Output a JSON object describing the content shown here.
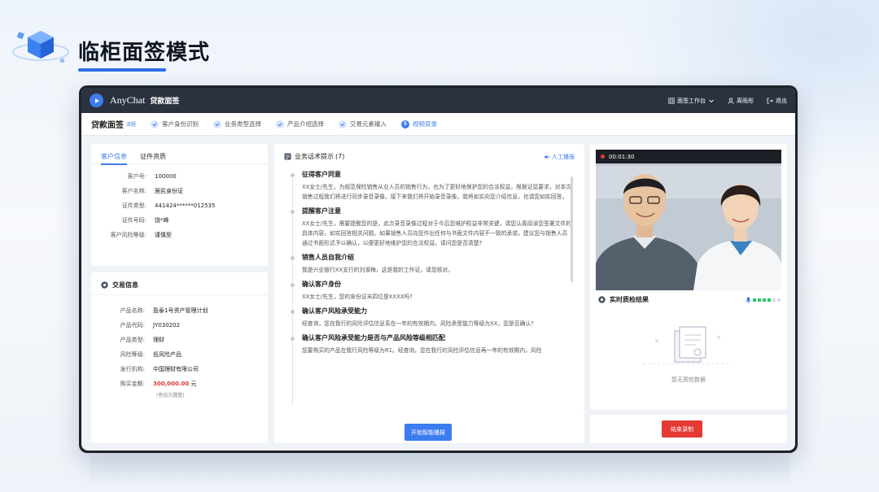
{
  "hero": {
    "title": "临柜面签模式"
  },
  "topbar": {
    "brand": "AnyChat",
    "app_name": "贷款面签",
    "workspace": "面签工作台",
    "user": "周雨彤",
    "logout": "退出"
  },
  "stepbar": {
    "title": "贷款面签",
    "tag": "流程",
    "steps": [
      {
        "label": "客户身份识别"
      },
      {
        "label": "业务类型选择"
      },
      {
        "label": "产品介绍选择"
      },
      {
        "label": "交易元素输入"
      },
      {
        "label": "视频双录",
        "num": "5"
      }
    ]
  },
  "customer": {
    "tabs": [
      "客户信息",
      "证件资质"
    ],
    "fields": [
      {
        "k": "客户号:",
        "v": "100000"
      },
      {
        "k": "客户名称:",
        "v": "居民身份证"
      },
      {
        "k": "证件类型:",
        "v": "441424******012535"
      },
      {
        "k": "证件号码:",
        "v": "饶*峰"
      },
      {
        "k": "客户风险等级:",
        "v": "谨慎型"
      }
    ]
  },
  "trade": {
    "title": "交易信息",
    "fields": [
      {
        "k": "产品名称:",
        "v": "盈泰1号资产管理计划"
      },
      {
        "k": "产品代码:",
        "v": "JY030202"
      },
      {
        "k": "产品类型:",
        "v": "理财"
      },
      {
        "k": "风险等级:",
        "v": "低风险产品"
      },
      {
        "k": "发行机构:",
        "v": "中国理财有限公司"
      }
    ],
    "amount_label": "购买金额:",
    "amount": "300,000.00",
    "amount_unit": "元",
    "amount_note": "(叁拾万圆整)"
  },
  "script": {
    "title": "业务话术提示",
    "count": "(7)",
    "manual": "人工播报",
    "items": [
      {
        "title": "征得客户同意",
        "body": "XX女士/先生，为规范保险销售从业人员的销售行为，也为了更好地保护您的合法权益，根据证监要求，对本次销售过程我们将进行同步录音录像。接下来我们将开始录音录像，我将如实向您介绍信息，也请您如实回答。"
      },
      {
        "title": "提醒客户注意",
        "body": "XX女士/先生，需要提醒您的是，此次录音录像过程对于今后您维护权益非常关键，请您认真阅读您签署文件的具体内容，如实回答相关问题。如果销售人员向您作出任何与书面文件内容不一致的承诺，建议您与销售人员通过书面形式予以确认，以便更好地维护您的合法权益。请问您是否清楚?"
      },
      {
        "title": "销售人员自我介绍",
        "body": "我是兴业银行XX支行的刘淑梅，这是我的工作证，请您核对。"
      },
      {
        "title": "确认客户身份",
        "body": "XX女士/先生，您的身份证末四位是XXXX吗?"
      },
      {
        "title": "确认客户风险承受能力",
        "body": "经查询，您在我行的风险评估信息系在一年的有效期内，风险承受能力等级为XX，您是否确认?"
      },
      {
        "title": "确认客户风险承受能力是否与产品风险等级相匹配",
        "body": "您要购买的产品在我行风险等级为R1。经查询，您在我行的风险评估信息再一年的有效期内，风险"
      }
    ],
    "start_button": "开始智能播报"
  },
  "video": {
    "timer": "00:01:30",
    "qc_title": "实时质检结果",
    "empty": "暂无质检数据",
    "end_button": "结束录制"
  }
}
